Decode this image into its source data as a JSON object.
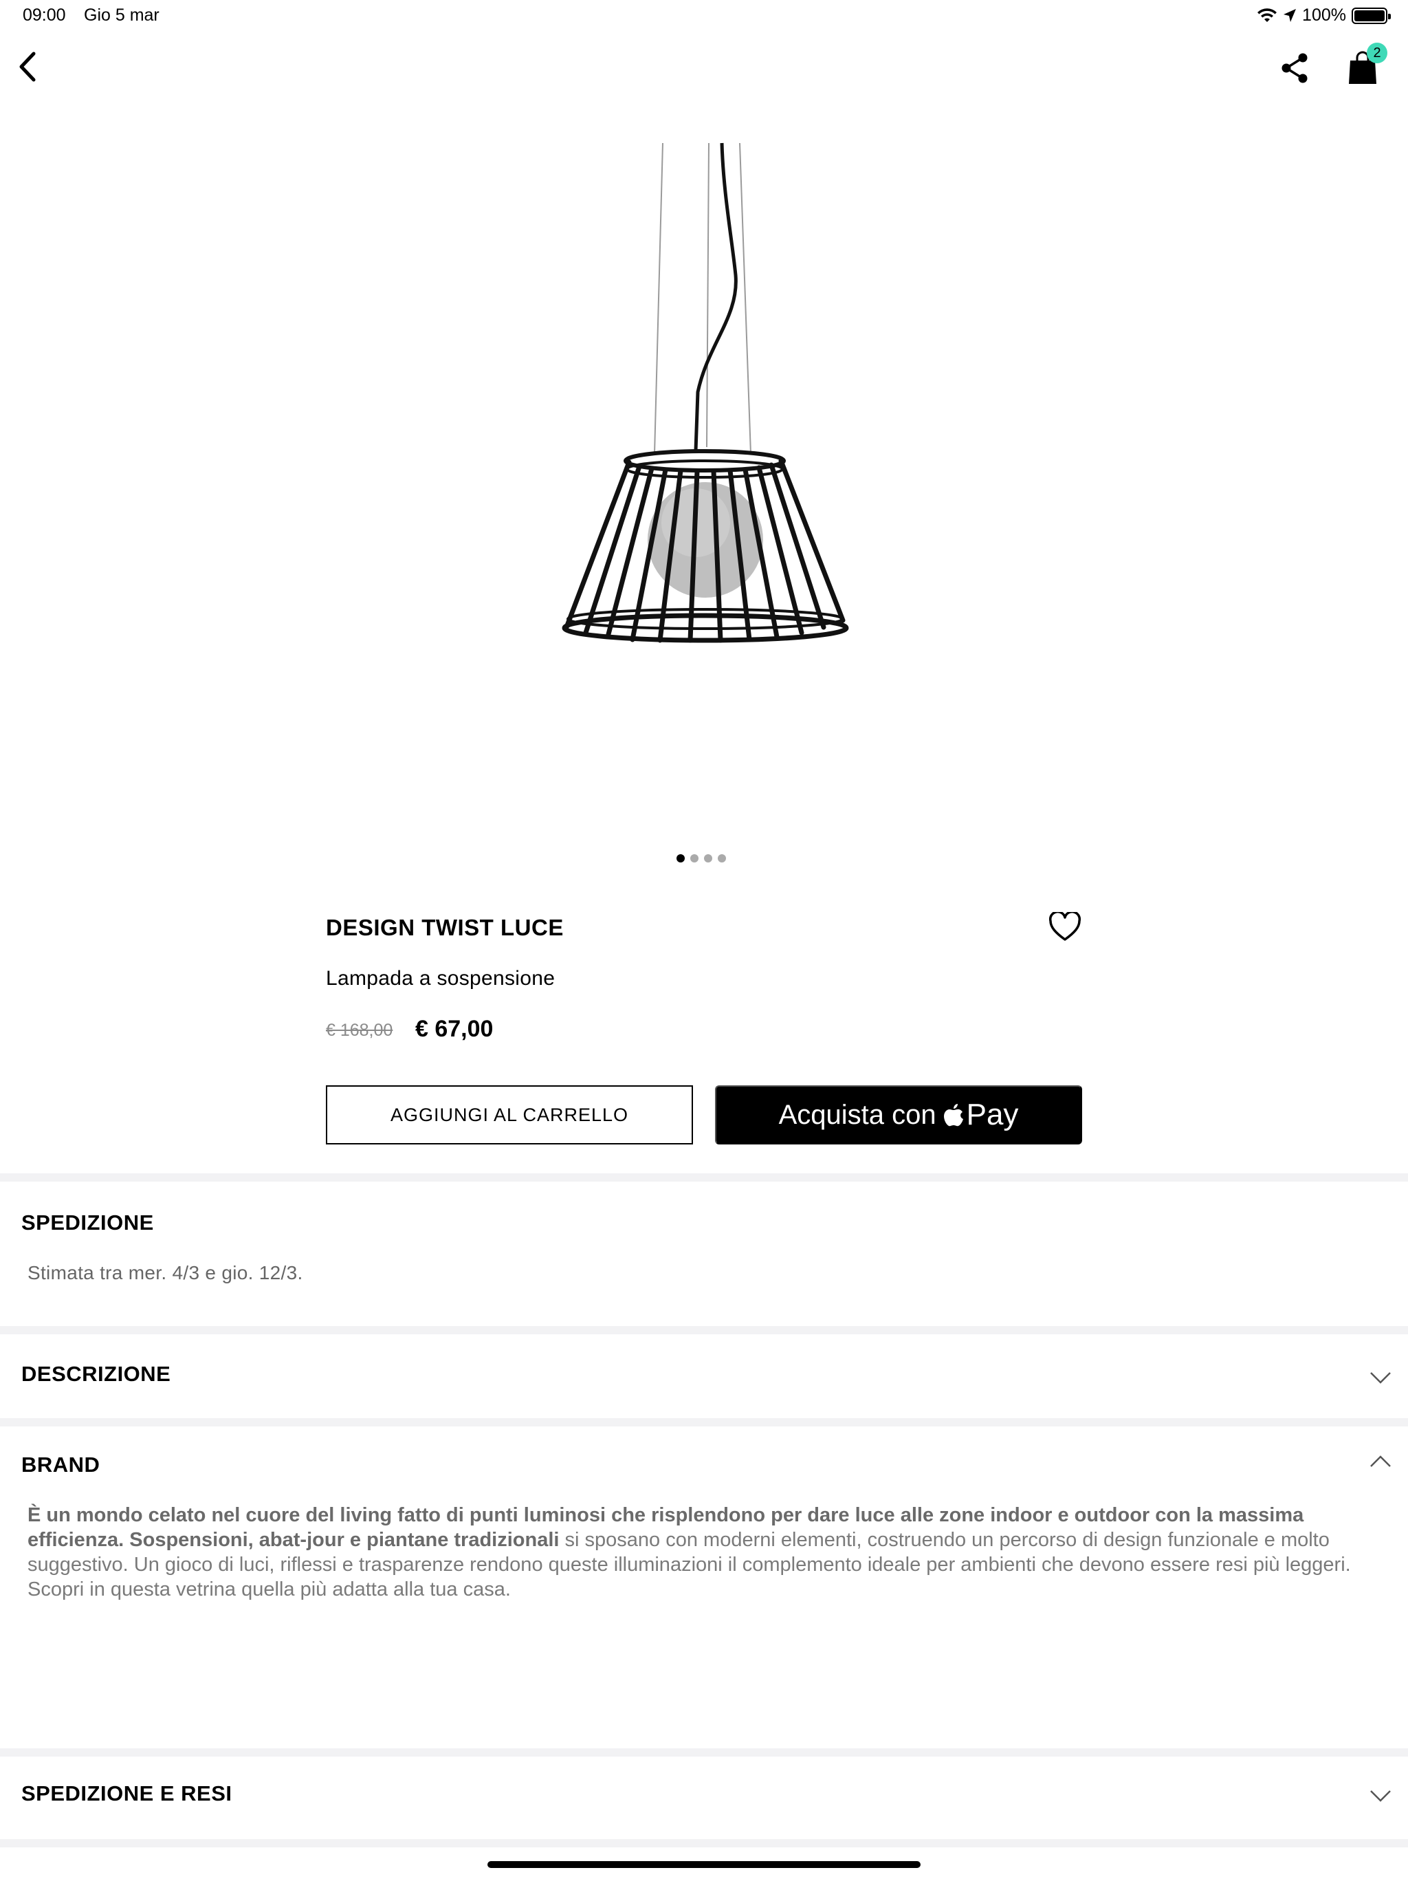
{
  "status_bar": {
    "time": "09:00",
    "date": "Gio 5 mar",
    "battery": "100%"
  },
  "nav": {
    "cart_count": "2"
  },
  "pager": {
    "total": 4,
    "active": 0
  },
  "product": {
    "name": "DESIGN TWIST LUCE",
    "subtitle": "Lampada a sospensione",
    "old_price": "€ 168,00",
    "price": "€ 67,00",
    "add_to_cart_label": "AGGIUNGI AL CARRELLO",
    "apple_pay_prefix": "Acquista con",
    "apple_pay_word": "Pay"
  },
  "sections": {
    "shipping": {
      "title": "SPEDIZIONE",
      "body": "Stimata tra mer. 4/3 e gio. 12/3."
    },
    "description": {
      "title": "DESCRIZIONE"
    },
    "brand": {
      "title": "BRAND",
      "text_bold_1": "È un mondo celato nel cuore del living fatto di punti luminosi che risplendono per dare luce alle zone indoor e outdoor con la massima efficienza. Sospensioni, abat-jour e piantane tradizionali",
      "text_rest": " si sposano con moderni elementi, costruendo un percorso di design funzionale e molto suggestivo. Un gioco di luci, riflessi e trasparenze rendono queste illuminazioni il complemento ideale per ambienti che devono essere resi più leggeri. Scopri in questa vetrina quella più adatta alla tua casa."
    },
    "returns": {
      "title": "SPEDIZIONE E RESI"
    }
  },
  "colors": {
    "badge": "#3fd9b7",
    "divider": "#f2f2f4"
  },
  "icons": [
    "back-chevron-icon",
    "share-icon",
    "shopping-bag-icon",
    "heart-icon",
    "chevron-down-icon",
    "chevron-up-icon",
    "apple-logo-icon",
    "wifi-icon",
    "location-arrow-icon",
    "battery-icon"
  ]
}
